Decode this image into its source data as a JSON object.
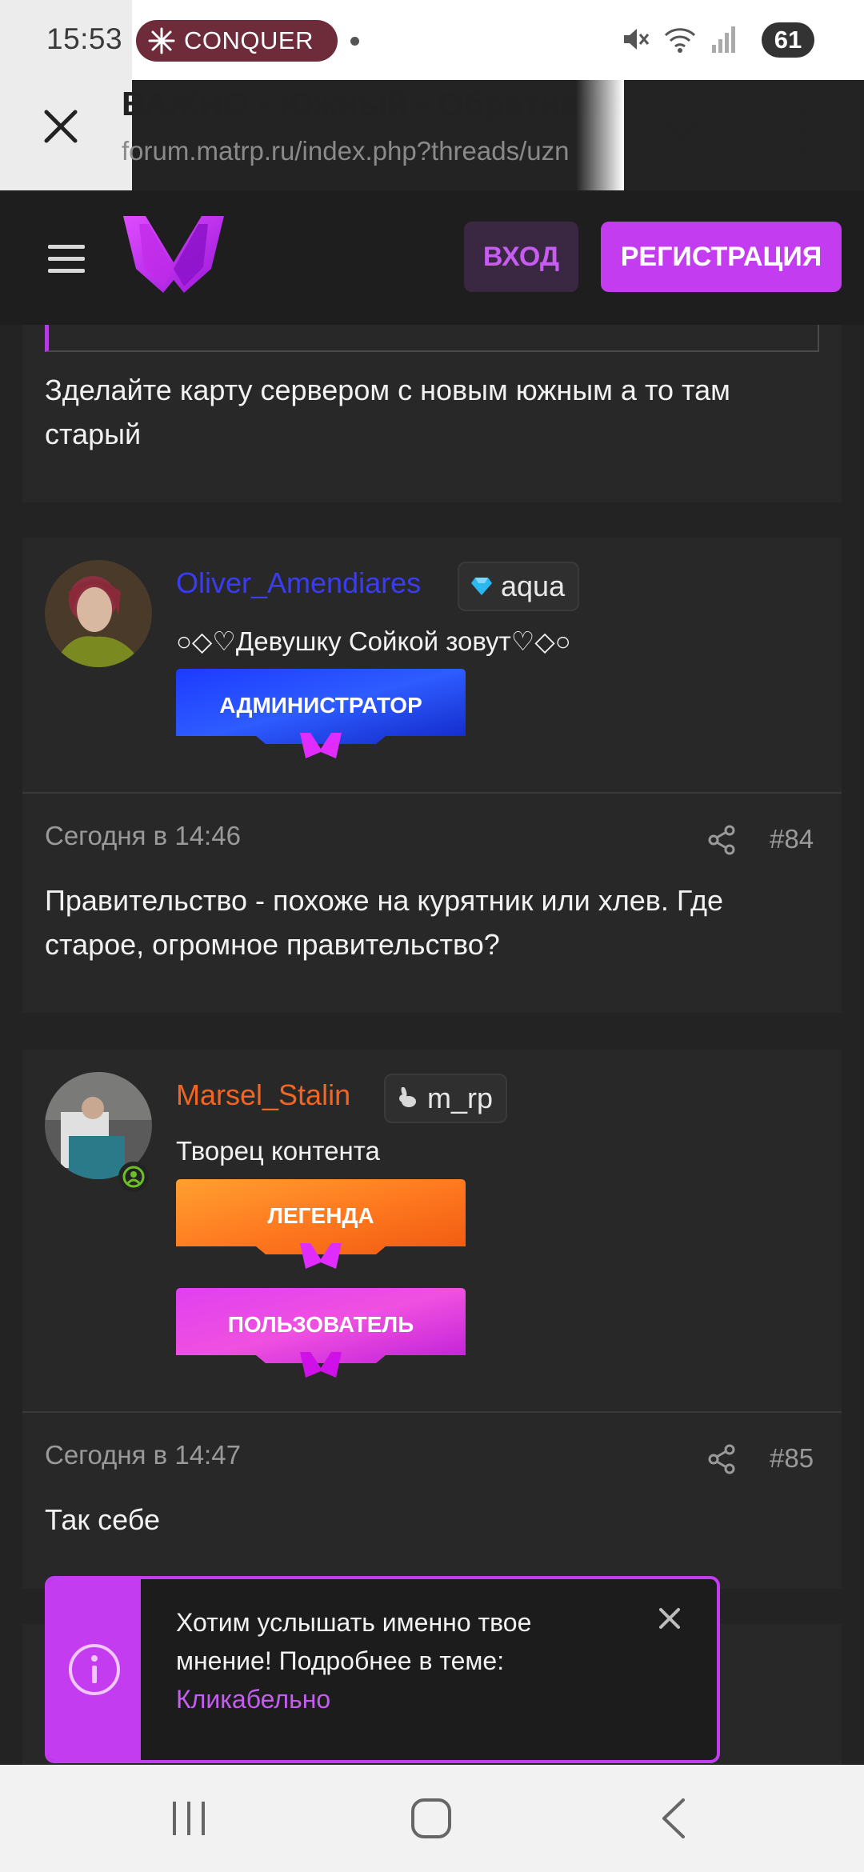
{
  "status_bar": {
    "time": "15:53",
    "notification_pill": "CONQUER",
    "battery": "61"
  },
  "browser": {
    "title": "ВАЖНО - Южный - Обратная связь",
    "url": "forum.matrp.ru/index.php?threads/uzn"
  },
  "site_header": {
    "login_label": "ВХОД",
    "register_label": "РЕГИСТРАЦИЯ"
  },
  "posts": [
    {
      "text": "Зделайте карту сервером с новым южным а то там старый"
    },
    {
      "author": "Oliver_Amendiares",
      "author_color": "#3a3cf2",
      "server_badge": "aqua",
      "user_title": "○◇♡Девушку Сойкой зовут♡◇○",
      "ranks": [
        "АДМИНИСТРАТОР"
      ],
      "date": "Сегодня в 14:46",
      "number": "#84",
      "text": "Правительство - похоже на курятник или хлев. Где старое, огромное правительство?"
    },
    {
      "author": "Marsel_Stalin",
      "author_color": "#f26522",
      "server_badge": "m_rp",
      "user_title": "Творец контента",
      "ranks": [
        "ЛЕГЕНДА",
        "ПОЛЬЗОВАТЕЛЬ"
      ],
      "date": "Сегодня в 14:47",
      "number": "#85",
      "text": "Так себе"
    }
  ],
  "notice": {
    "message": "Хотим услышать именно твое мнение! Подробнее в теме:",
    "link_text": "Кликабельно"
  },
  "colors": {
    "accent": "#c43cf0",
    "background": "#232323",
    "card": "#282828"
  }
}
